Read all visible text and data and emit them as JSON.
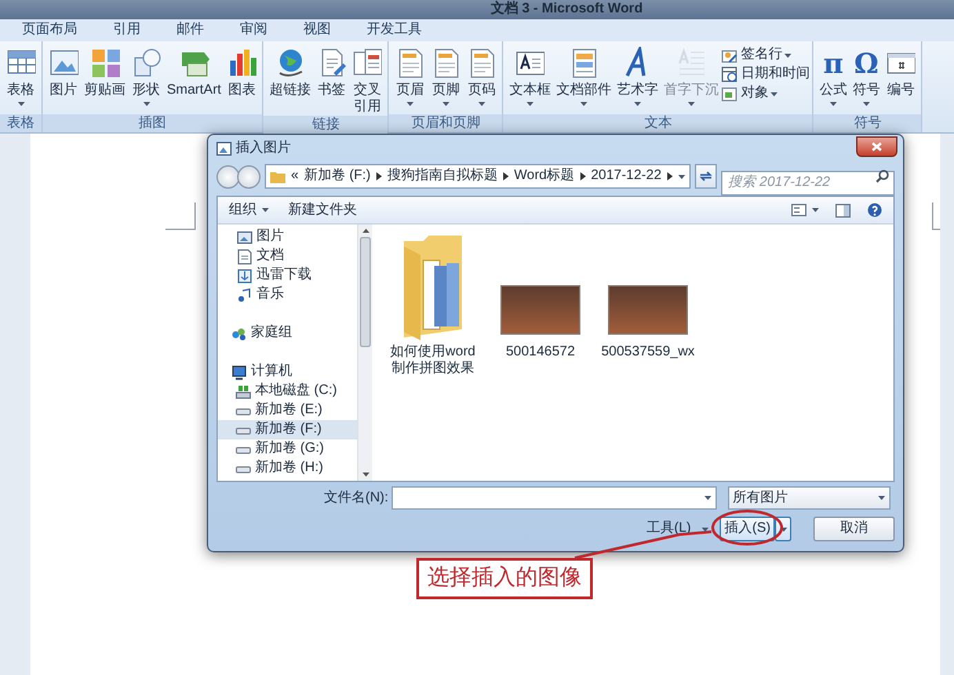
{
  "window": {
    "title": "文档 3 - Microsoft Word"
  },
  "tabs": [
    {
      "label": "页面布局",
      "selected": false
    },
    {
      "label": "引用",
      "selected": false
    },
    {
      "label": "邮件",
      "selected": false
    },
    {
      "label": "审阅",
      "selected": false
    },
    {
      "label": "视图",
      "selected": false
    },
    {
      "label": "开发工具",
      "selected": false
    }
  ],
  "ribbon_groups": [
    {
      "label": "表格",
      "buttons": [
        {
          "kind": "big",
          "label": "表格",
          "dropdown": true,
          "disabled": false
        }
      ]
    },
    {
      "label": "插图",
      "buttons": [
        {
          "kind": "big",
          "label": "图片",
          "dropdown": false,
          "disabled": false
        },
        {
          "kind": "big",
          "label": "剪贴画",
          "dropdown": false,
          "disabled": false
        },
        {
          "kind": "big",
          "label": "形状",
          "dropdown": true,
          "disabled": false
        },
        {
          "kind": "big",
          "label": "SmartArt",
          "dropdown": false,
          "disabled": false
        },
        {
          "kind": "big",
          "label": "图表",
          "dropdown": false,
          "disabled": false
        }
      ]
    },
    {
      "label": "链接",
      "buttons": [
        {
          "kind": "big",
          "label": "超链接",
          "dropdown": false,
          "disabled": false
        },
        {
          "kind": "big",
          "label": "书签",
          "dropdown": false,
          "disabled": false
        },
        {
          "kind": "big",
          "lines": [
            "交叉",
            "引用"
          ],
          "dropdown": false,
          "disabled": false
        }
      ]
    },
    {
      "label": "页眉和页脚",
      "buttons": [
        {
          "kind": "big",
          "label": "页眉",
          "dropdown": true,
          "disabled": false
        },
        {
          "kind": "big",
          "label": "页脚",
          "dropdown": true,
          "disabled": false
        },
        {
          "kind": "big",
          "label": "页码",
          "dropdown": true,
          "disabled": false
        }
      ]
    },
    {
      "label": "文本",
      "buttons": [
        {
          "kind": "big",
          "label": "文本框",
          "dropdown": true,
          "disabled": false
        },
        {
          "kind": "big",
          "label": "文档部件",
          "dropdown": true,
          "disabled": false
        },
        {
          "kind": "big",
          "label": "艺术字",
          "dropdown": true,
          "disabled": false
        },
        {
          "kind": "big",
          "label": "首字下沉",
          "dropdown": true,
          "disabled": true
        },
        {
          "kind": "small",
          "label": "签名行",
          "dropdown": true,
          "disabled": false
        },
        {
          "kind": "small",
          "label": "日期和时间",
          "dropdown": false,
          "disabled": false
        },
        {
          "kind": "small",
          "label": "对象",
          "dropdown": true,
          "disabled": false
        }
      ]
    },
    {
      "label": "符号",
      "buttons": [
        {
          "kind": "big",
          "glyph": "π",
          "label": "公式",
          "dropdown": true,
          "disabled": false
        },
        {
          "kind": "big",
          "glyph": "Ω",
          "label": "符号",
          "dropdown": true,
          "disabled": false
        },
        {
          "kind": "big",
          "label": "编号",
          "dropdown": false,
          "disabled": false
        }
      ]
    }
  ],
  "dialog": {
    "title": "插入图片",
    "address": [
      "«",
      "新加卷 (F:)",
      "搜狗指南自拟标题",
      "Word标题",
      "2017-12-22"
    ],
    "search": {
      "placeholder": "搜索 2017-12-22"
    },
    "toolbar": [
      {
        "label": "组织",
        "dropdown": true
      },
      {
        "label": "新建文件夹",
        "dropdown": false
      }
    ],
    "nav": [
      {
        "label": "图片",
        "kind": "pictures",
        "selected": false
      },
      {
        "label": "文档",
        "kind": "documents",
        "selected": false
      },
      {
        "label": "迅雷下载",
        "kind": "downloads",
        "selected": false
      },
      {
        "label": "音乐",
        "kind": "music",
        "selected": false
      },
      {
        "label": "家庭组",
        "kind": "homegroup",
        "selected": false
      },
      {
        "label": "计算机",
        "kind": "computer",
        "selected": false,
        "children": [
          {
            "label": "本地磁盘 (C:)",
            "kind": "system-drive",
            "selected": false
          },
          {
            "label": "新加卷 (E:)",
            "kind": "drive",
            "selected": false
          },
          {
            "label": "新加卷 (F:)",
            "kind": "drive",
            "selected": true
          },
          {
            "label": "新加卷 (G:)",
            "kind": "drive",
            "selected": false
          },
          {
            "label": "新加卷 (H:)",
            "kind": "drive",
            "selected": false
          }
        ]
      }
    ],
    "files": [
      {
        "kind": "folder",
        "label": "如何使用word制作拼图效果"
      },
      {
        "kind": "photo",
        "label": "500146572"
      },
      {
        "kind": "photo",
        "label": "500537559_wx"
      }
    ],
    "filename": {
      "label": "文件名(N):"
    },
    "filter": "所有图片",
    "tools": "工具(L)",
    "insert": "插入(S)",
    "cancel": "取消"
  },
  "annotation": {
    "text": "选择插入的图像"
  }
}
